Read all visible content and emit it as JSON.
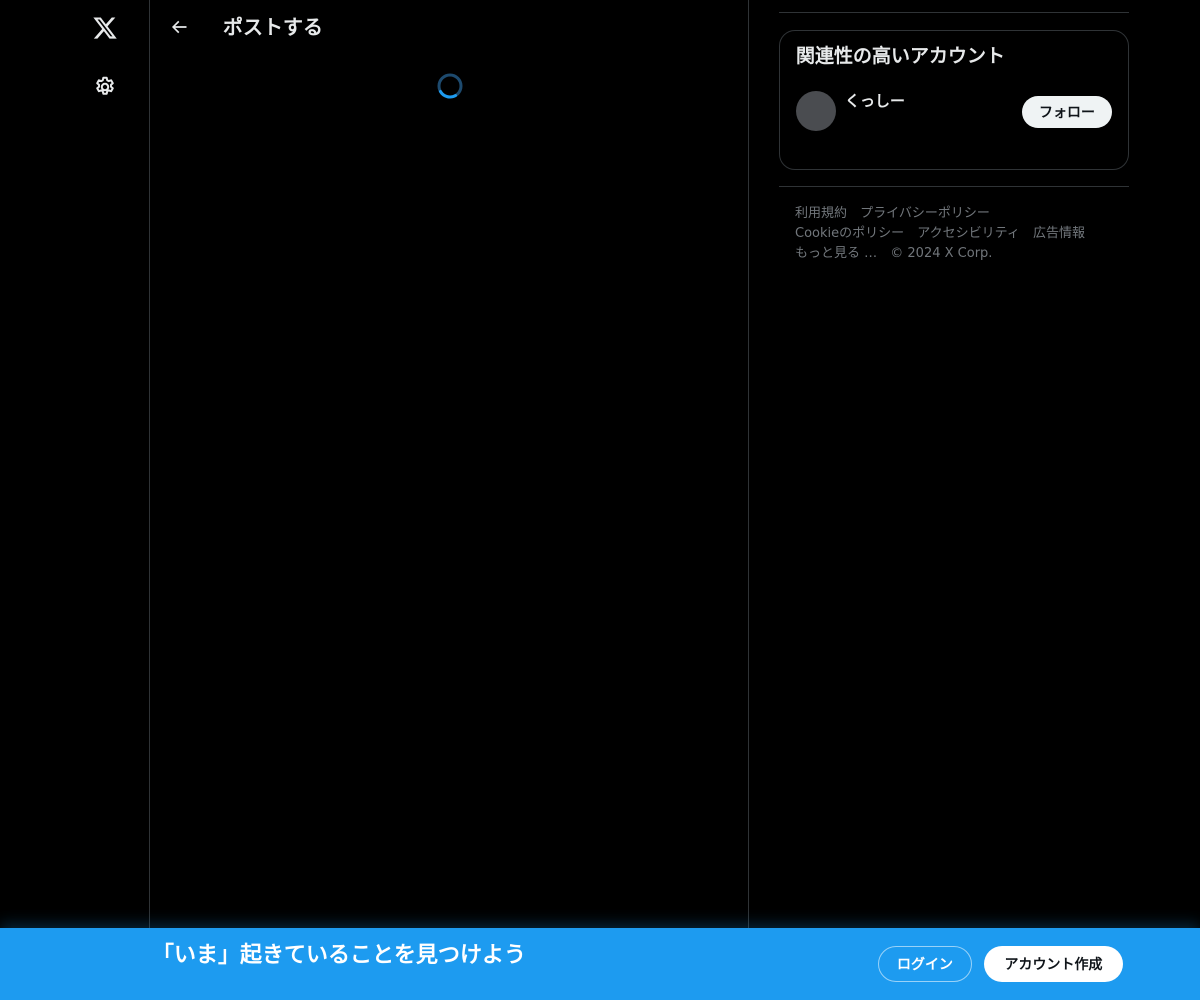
{
  "nav": {
    "logo_icon": "x-logo-icon",
    "settings_icon": "gear-icon"
  },
  "header": {
    "back_icon": "arrow-left-icon",
    "title": "ポストする"
  },
  "main": {
    "loading_icon": "spinner-icon"
  },
  "sidebar": {
    "related": {
      "title": "関連性の高いアカウント",
      "accounts": [
        {
          "name": "くっしー",
          "follow_label": "フォロー"
        }
      ]
    },
    "footer": {
      "links": [
        "利用規約",
        "プライバシーポリシー",
        "Cookieのポリシー",
        "アクセシビリティ",
        "広告情報",
        "もっと見る …"
      ],
      "copyright": "© 2024 X Corp."
    }
  },
  "banner": {
    "headline": "「いま」起きていることを見つけよう",
    "login_label": "ログイン",
    "signup_label": "アカウント作成"
  },
  "colors": {
    "background": "#000000",
    "accent": "#1d9bf0",
    "border": "#2f3336",
    "muted_text": "#71767b"
  }
}
